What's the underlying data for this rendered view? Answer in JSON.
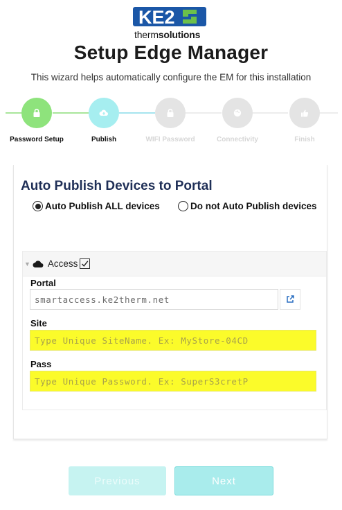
{
  "brand": {
    "logo_main": "KE2",
    "logo_sub_thin": "therm",
    "logo_sub_bold": "solutions",
    "colors": {
      "blue": "#1b57a7",
      "green": "#6cc04a"
    }
  },
  "header": {
    "title": "Setup Edge Manager",
    "subtitle": "This wizard helps automatically configure the EM for this installation"
  },
  "stepper": {
    "steps": [
      {
        "label": "Password Setup",
        "state": "done",
        "icon": "lock-icon"
      },
      {
        "label": "Publish",
        "state": "current",
        "icon": "cloud-upload-icon"
      },
      {
        "label": "WIFI Password",
        "state": "todo",
        "icon": "lock-icon"
      },
      {
        "label": "Connectivity",
        "state": "todo",
        "icon": "globe-icon"
      },
      {
        "label": "Finish",
        "state": "todo",
        "icon": "thumbs-up-icon"
      }
    ],
    "colors": {
      "done": "#8ee37c",
      "current": "#a6eef0",
      "todo": "#e4e4e4"
    }
  },
  "card": {
    "title": "Auto Publish Devices to Portal",
    "radio_all": "Auto Publish ALL devices",
    "radio_none": "Do not Auto Publish devices",
    "selected": "all",
    "access": {
      "label": "Access",
      "checked": true,
      "portal_label": "Portal",
      "portal_value": "smartaccess.ke2therm.net",
      "site_label": "Site",
      "site_placeholder": "Type Unique SiteName. Ex: MyStore-04CD",
      "pass_label": "Pass",
      "pass_placeholder": "Type Unique Password. Ex: SuperS3cretP"
    }
  },
  "footer": {
    "previous_label": "Previous",
    "next_label": "Next"
  }
}
